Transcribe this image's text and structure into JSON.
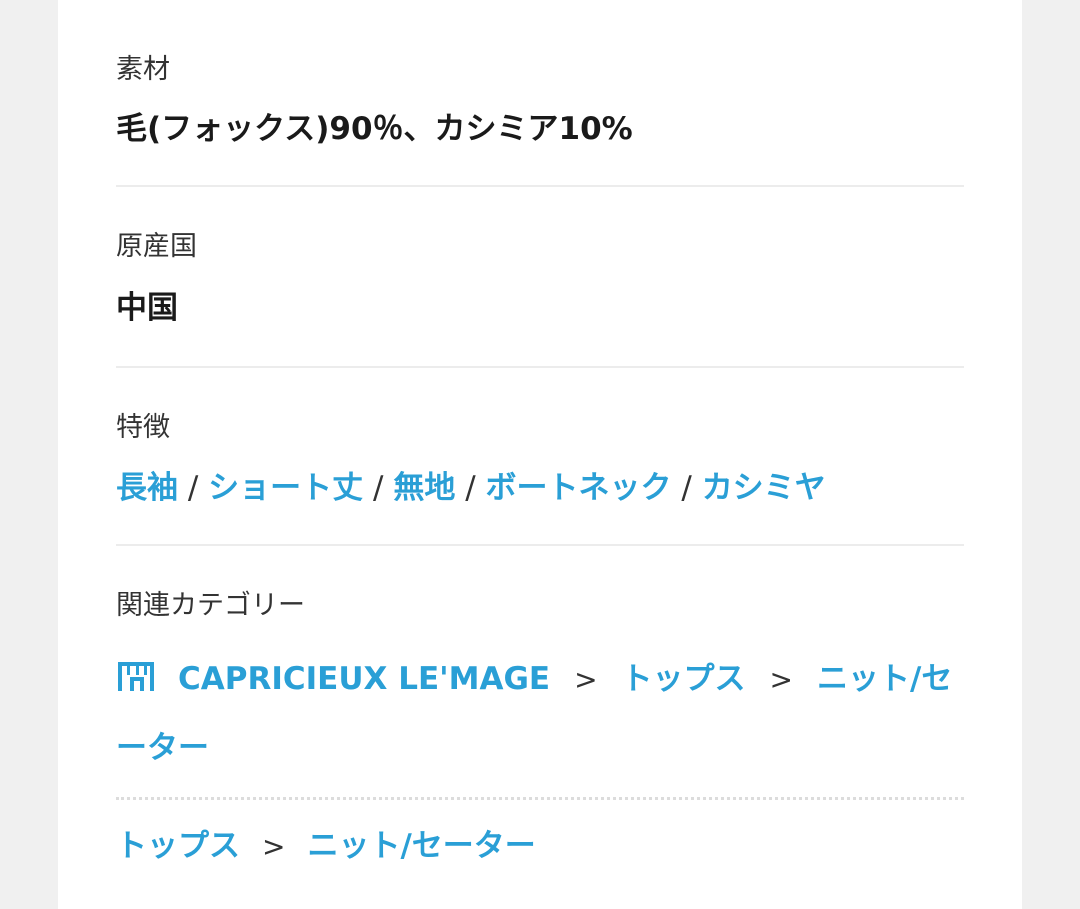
{
  "material": {
    "label": "素材",
    "value": "毛(フォックス)90％、カシミア10%"
  },
  "origin": {
    "label": "原産国",
    "value": "中国"
  },
  "features": {
    "label": "特徴",
    "separator": "/",
    "tags": [
      "長袖",
      "ショート丈",
      "無地",
      "ボートネック",
      "カシミヤ"
    ]
  },
  "related_categories": {
    "label": "関連カテゴリー",
    "arrow": ">",
    "shop_path": {
      "icon": "shop-icon",
      "brand": "CAPRICIEUX LE'MAGE",
      "category": "トップス",
      "subcategory_line1": "ニット/セ",
      "subcategory_line2": "ーター"
    },
    "general_path": {
      "category": "トップス",
      "subcategory": "ニット/セーター"
    }
  },
  "colors": {
    "link": "#2a9fd6",
    "text": "#1a1a1a",
    "divider": "#ececec"
  }
}
